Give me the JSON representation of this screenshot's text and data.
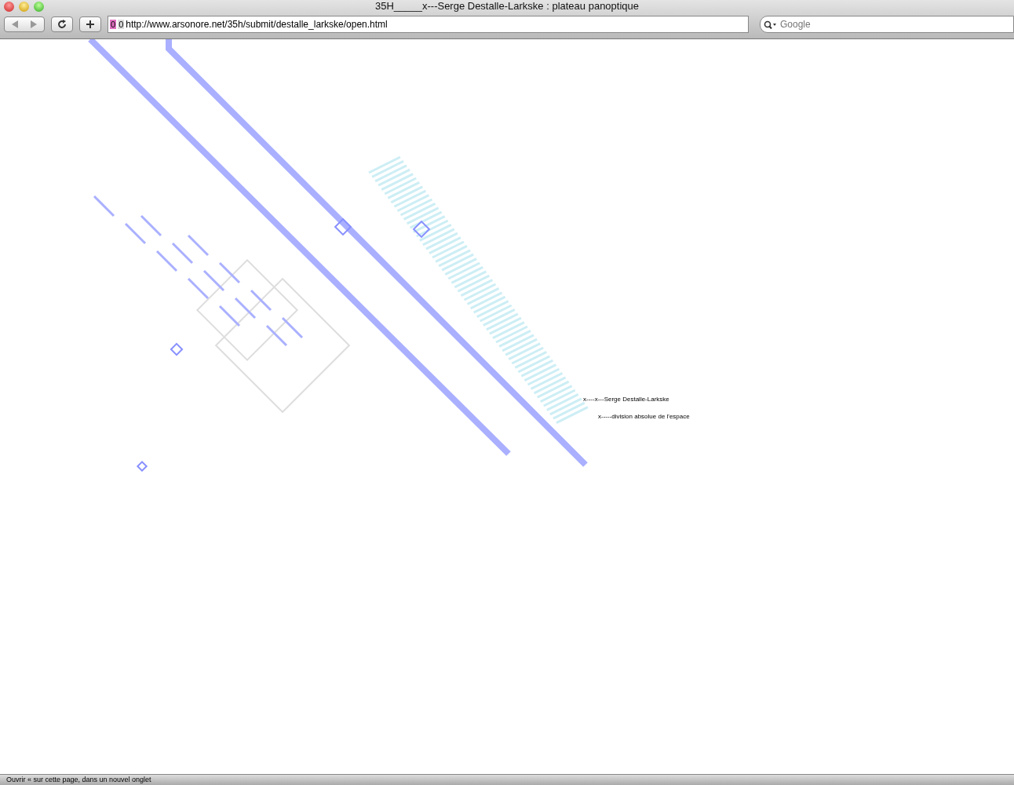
{
  "window": {
    "title": "35H_____x---Serge Destalle-Larkske : plateau panoptique"
  },
  "toolbar": {
    "address": {
      "counters": [
        "0",
        "0"
      ],
      "url": "http://www.arsonore.net/35h/submit/destalle_larkske/open.html"
    },
    "search": {
      "placeholder": "Google"
    }
  },
  "canvas": {
    "labels": [
      {
        "text": "x----x---Serge Destalle-Larkske"
      },
      {
        "text": "x-----division absolue de l'espace"
      }
    ]
  },
  "status_bar": {
    "text": "Ouvrir « sur cette page, dans un nouvel onglet"
  }
}
